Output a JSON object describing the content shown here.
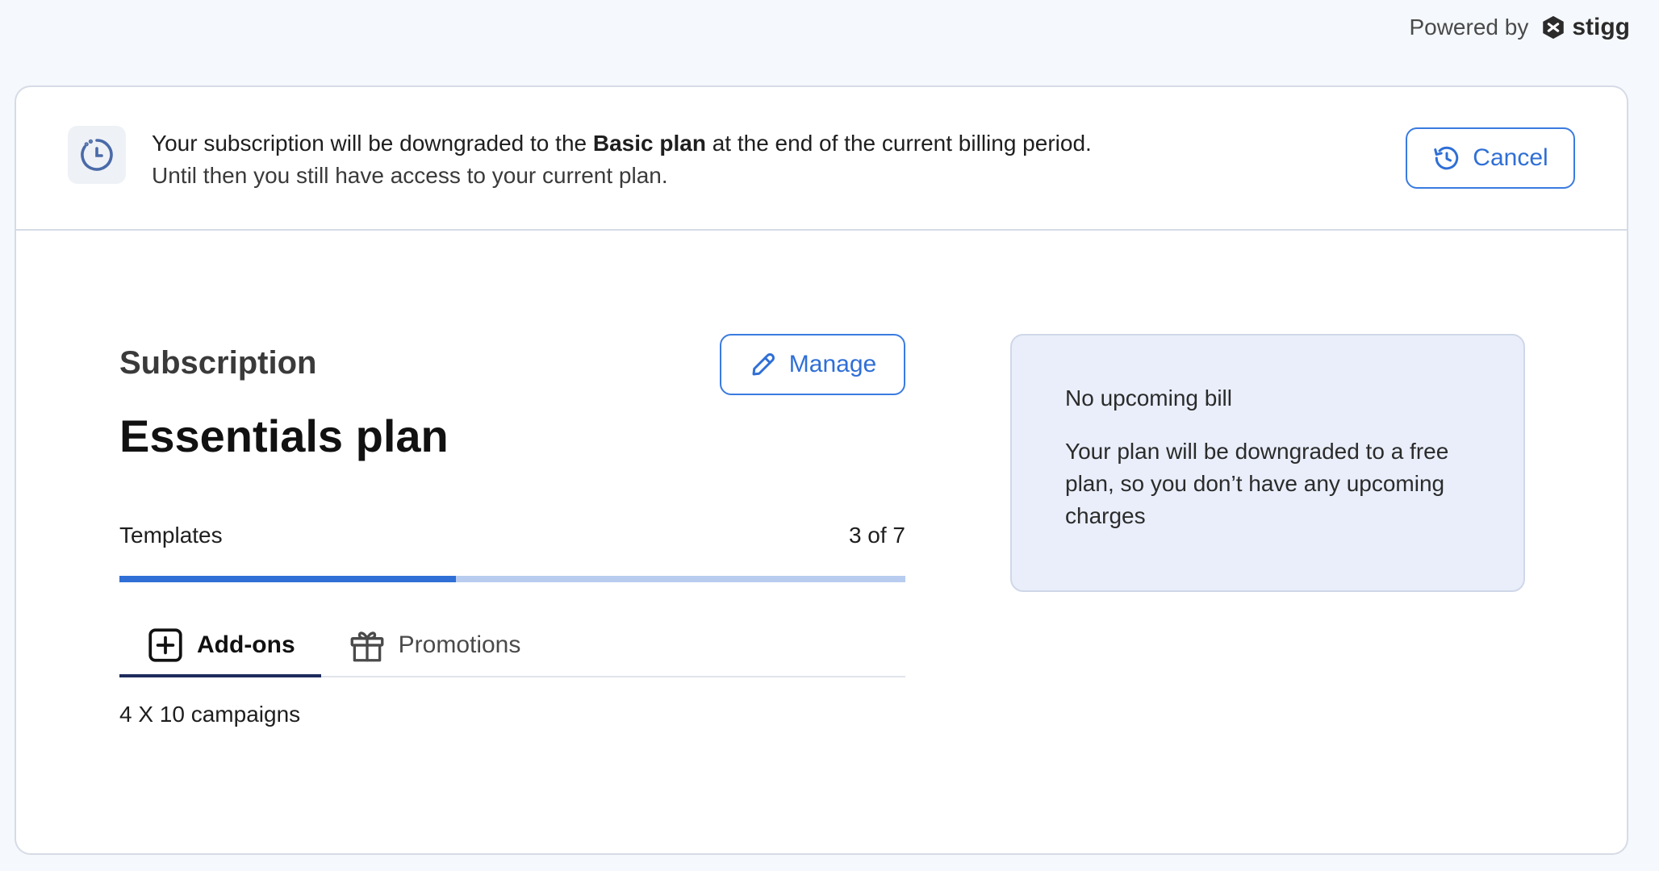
{
  "powered_by": {
    "label": "Powered by",
    "brand": "stigg"
  },
  "banner": {
    "message_prefix": "Your subscription will be downgraded to the ",
    "message_plan": "Basic plan",
    "message_suffix": " at the end of the current billing period.",
    "message_line2": "Until then you still have access to your current plan.",
    "cancel_label": "Cancel"
  },
  "subscription": {
    "heading": "Subscription",
    "manage_label": "Manage",
    "plan_name": "Essentials plan",
    "usage": {
      "feature": "Templates",
      "count_text": "3 of 7",
      "used": 3,
      "limit": 7
    }
  },
  "tabs": [
    {
      "label": "Add-ons",
      "icon": "plus-square-icon",
      "active": true
    },
    {
      "label": "Promotions",
      "icon": "gift-icon",
      "active": false
    }
  ],
  "addons": [
    "4 X 10 campaigns"
  ],
  "billing": {
    "title": "No upcoming bill",
    "description": "Your plan will be downgraded to a free plan, so you don’t have any upcoming charges"
  },
  "colors": {
    "accent": "#2f6fd6",
    "progress_track": "#b8ccef",
    "tab_underline": "#1d2b5c",
    "bill_bg": "#e9eefa"
  }
}
